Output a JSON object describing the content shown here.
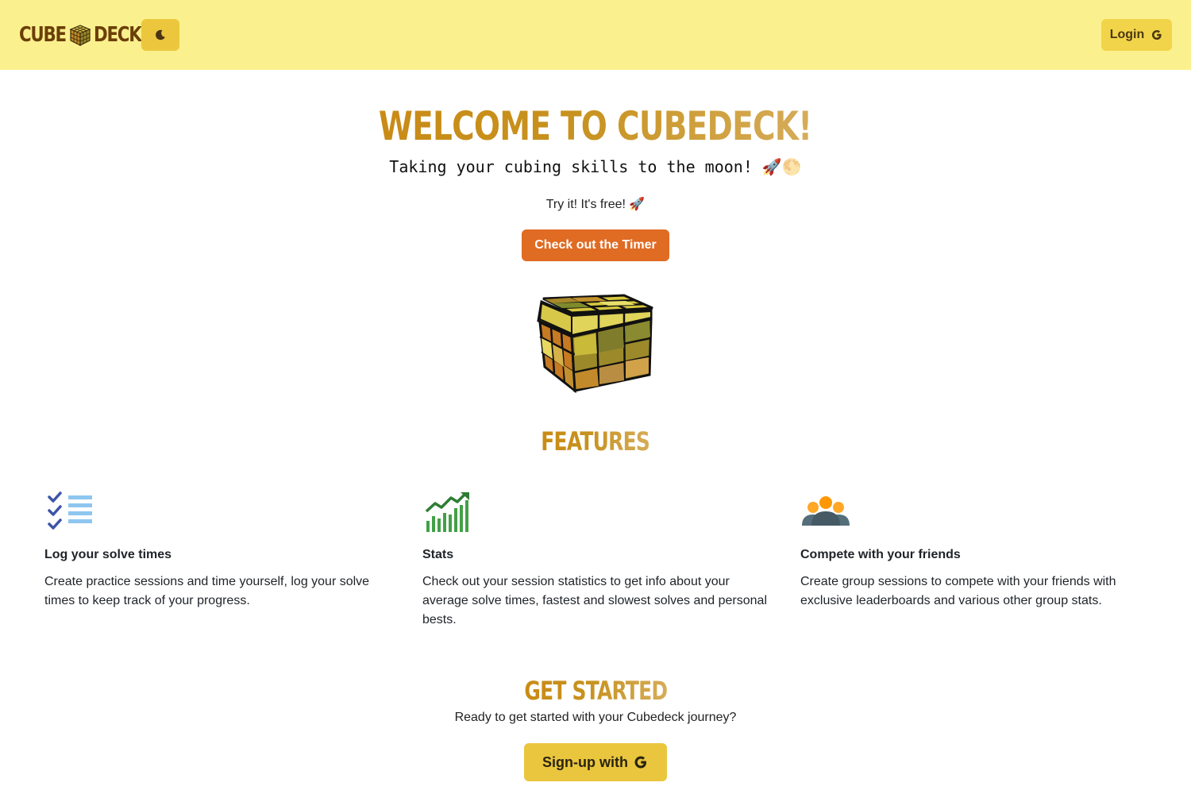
{
  "header": {
    "logo_left": "CUBE",
    "logo_right": "DECK",
    "theme_toggle_icon": "moon-icon",
    "login_label": "Login",
    "login_icon": "google-icon",
    "bg_color": "#fbf08e"
  },
  "hero": {
    "title": "WELCOME TO CUBEDECK!",
    "tagline": "Taking your cubing skills to the moon! 🚀🌕",
    "try_text": "Try it! It's free! 🚀",
    "timer_button": "Check out the Timer",
    "timer_button_color": "#e06b23"
  },
  "features": {
    "title": "FEATURES",
    "items": [
      {
        "icon": "checklist-icon",
        "title": "Log your solve times",
        "text": "Create practice sessions and time yourself, log your solve times to keep track of your progress."
      },
      {
        "icon": "chart-growth-icon",
        "title": "Stats",
        "text": "Check out your session statistics to get info about your average solve times, fastest and slowest solves and personal bests."
      },
      {
        "icon": "group-icon",
        "title": "Compete with your friends",
        "text": "Create group sessions to compete with your friends with exclusive leaderboards and various other group stats."
      }
    ]
  },
  "get_started": {
    "title": "GET STARTED",
    "text": "Ready to get started with your Cubedeck journey?",
    "signup_label": "Sign-up with",
    "signup_icon": "google-icon"
  }
}
